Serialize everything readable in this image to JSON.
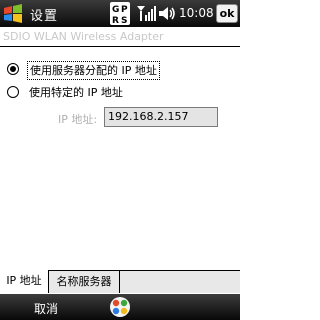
{
  "status_bar": {
    "title": "设置",
    "time": "10:08",
    "ok_label": "ok",
    "gprs_text": [
      "G",
      "P",
      "R",
      "S"
    ],
    "icons": [
      "windows-start-icon",
      "gprs-icon",
      "signal-icon",
      "volume-icon"
    ]
  },
  "header": {
    "subtitle": "SDIO WLAN Wireless Adapter"
  },
  "options": {
    "dhcp_label": "使用服务器分配的 IP 地址",
    "static_label": "使用特定的 IP 地址",
    "selected": "dhcp"
  },
  "ip_field": {
    "label": "IP 地址:",
    "value": "192.168.2.157"
  },
  "tabs": [
    {
      "label": "IP 地址",
      "active": true
    },
    {
      "label": "名称服务器",
      "active": false
    }
  ],
  "softkeys": {
    "left_label": "取消"
  }
}
